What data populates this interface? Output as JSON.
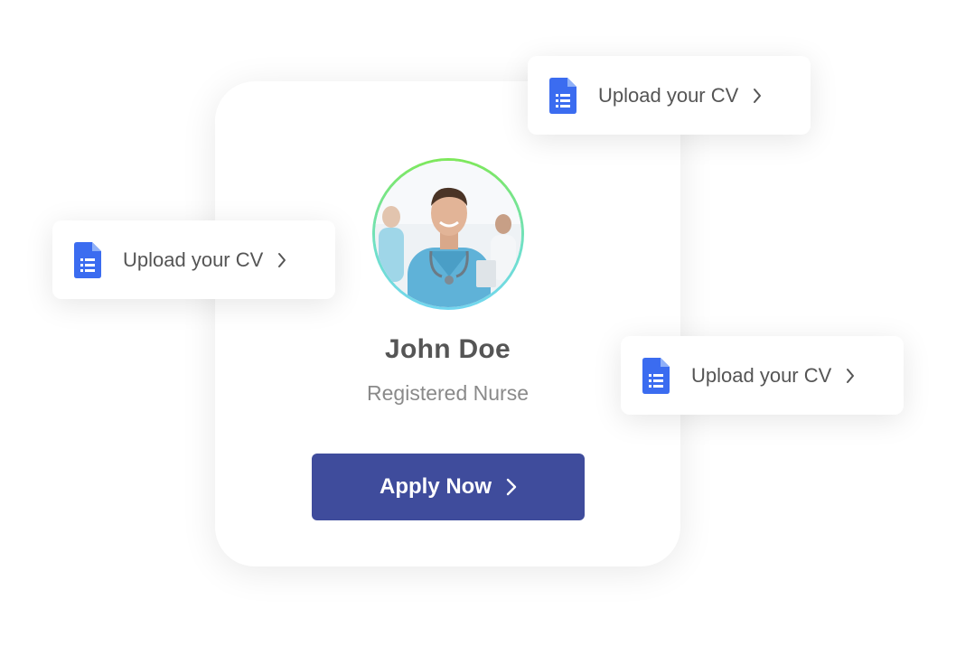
{
  "profile": {
    "name": "John Doe",
    "role": "Registered Nurse",
    "apply_label": "Apply Now"
  },
  "upload_cards": [
    {
      "label": "Upload your CV",
      "icon": "document-icon"
    },
    {
      "label": "Upload your CV",
      "icon": "document-icon"
    },
    {
      "label": "Upload your CV",
      "icon": "document-icon"
    }
  ],
  "colors": {
    "button": "#3f4c9c",
    "doc_icon": "#3b6cf0",
    "ring_top": "#7ee85a",
    "ring_bottom": "#72d6f0"
  }
}
